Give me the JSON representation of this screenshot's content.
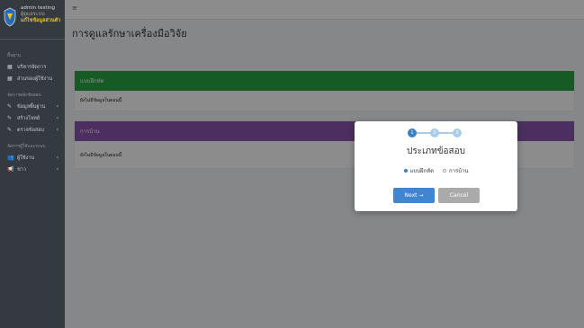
{
  "brand": {
    "name": "admin testing",
    "role": "ผู้ดูแลระบบ",
    "link": "แก้ไขข้อมูลส่วนตัว"
  },
  "sidebar": {
    "sections": [
      {
        "header": "พื้นฐาน",
        "items": [
          {
            "label": "บริหารจัดการ",
            "icon": "grid-icon",
            "has_arrow": false
          },
          {
            "label": "ส่วนของผู้ใช้งาน",
            "icon": "grid-icon",
            "has_arrow": false
          }
        ]
      },
      {
        "header": "จัดการคลังข้อสอบ",
        "items": [
          {
            "label": "ข้อมูลพื้นฐาน",
            "icon": "edit-icon",
            "has_arrow": true
          },
          {
            "label": "สร้างโจทย์",
            "icon": "edit-icon",
            "has_arrow": true
          },
          {
            "label": "ตรวจข้อสอบ",
            "icon": "edit-icon",
            "has_arrow": true
          }
        ]
      },
      {
        "header": "จัดการผู้ใช้และระบบ",
        "items": [
          {
            "label": "ผู้ใช้งาน",
            "icon": "users-icon",
            "has_arrow": true
          },
          {
            "label": "ข่าว",
            "icon": "megaphone-icon",
            "has_arrow": true
          }
        ]
      }
    ]
  },
  "topbar": {
    "menu_icon": "≡"
  },
  "page": {
    "title": "การดูแลรักษาเครื่องมือวิจัย"
  },
  "cards": [
    {
      "header": "แบบฝึกหัด",
      "color": "#28a745",
      "body": "ยังไม่มีข้อมูลในตอนนี้"
    },
    {
      "header": "การบ้าน",
      "color": "#8a56b0",
      "body": "ยังไม่มีข้อมูลในตอนนี้"
    }
  ],
  "modal": {
    "steps": [
      "1",
      "2",
      "3"
    ],
    "active_step": 1,
    "title": "ประเภทข้อสอบ",
    "options": [
      {
        "label": "แบบฝึกหัด",
        "selected": true
      },
      {
        "label": "การบ้าน",
        "selected": false
      }
    ],
    "next_label": "Next →",
    "cancel_label": "Cancel"
  },
  "colors": {
    "sidebar_bg": "#343a40",
    "accent": "#3f85cf",
    "exercise_header": "#28a745",
    "homework_header": "#8a56b0"
  }
}
